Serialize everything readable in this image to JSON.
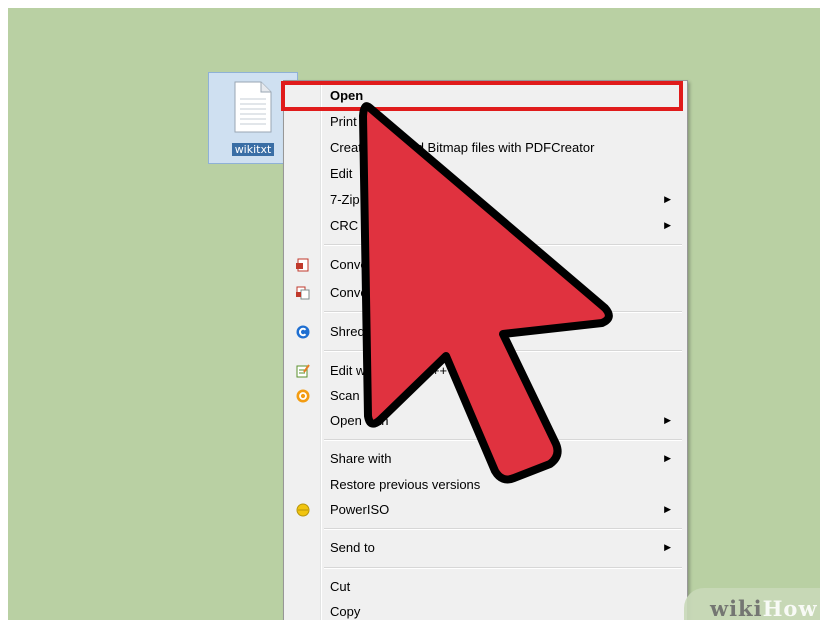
{
  "file": {
    "name": "wikitxt",
    "icon": "text-document-icon"
  },
  "context_menu": {
    "items": [
      {
        "label": "Open",
        "bold": true
      },
      {
        "label": "Print"
      },
      {
        "label": "Create PDF and Bitmap files with PDFCreator"
      },
      {
        "label": "Edit"
      },
      {
        "label": "7-Zip",
        "submenu": true
      },
      {
        "label": "CRC SHA",
        "submenu": true
      },
      {
        "label": "Convert",
        "icon": "pdf-convert-icon"
      },
      {
        "label": "Convert",
        "icon": "pdf-combine-icon"
      },
      {
        "label": "Shred",
        "icon": "shred-icon"
      },
      {
        "label": "Edit with Notepad++",
        "icon": "notepad-icon"
      },
      {
        "label": "Scan",
        "icon": "scan-icon"
      },
      {
        "label": "Open with",
        "submenu": true
      },
      {
        "label": "Share with",
        "submenu": true
      },
      {
        "label": "Restore previous versions"
      },
      {
        "label": "PowerISO",
        "submenu": true,
        "icon": "poweriso-icon"
      },
      {
        "label": "Send to",
        "submenu": true
      },
      {
        "label": "Cut"
      },
      {
        "label": "Copy"
      }
    ]
  },
  "overlay": {
    "highlight_color": "#e01b1b",
    "arrow_color": "#e0323f"
  },
  "watermark": {
    "part1": "wiki",
    "part2": "How"
  },
  "colors": {
    "background": "#b9d0a3",
    "menu_bg": "#f0f0f0"
  }
}
